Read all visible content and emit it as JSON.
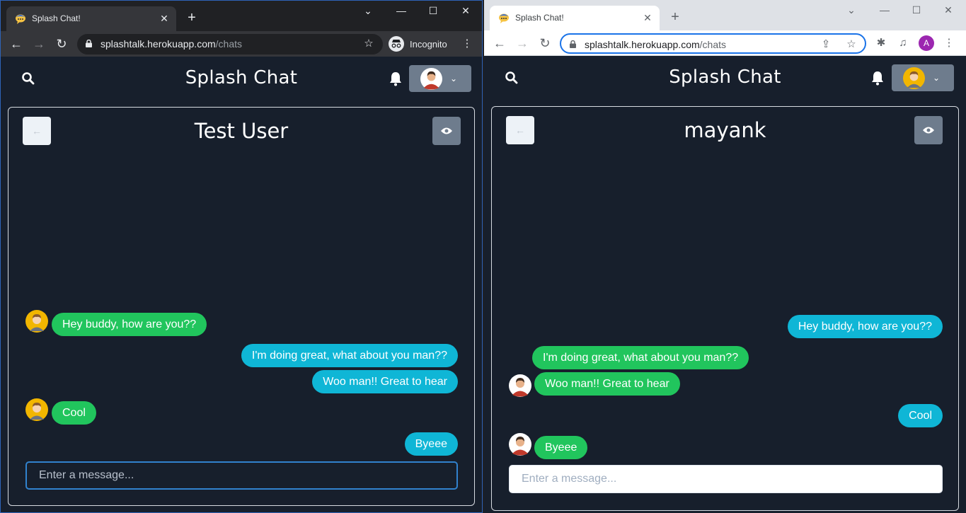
{
  "left": {
    "tab_title": "Splash Chat!",
    "url_host": "splashtalk.herokuapp.com",
    "url_path": "/chats",
    "incognito_label": "Incognito",
    "app_title": "Splash Chat",
    "chat_title": "Test User",
    "messages": [
      {
        "text": "Hey buddy, how are you??",
        "side": "left",
        "color": "green",
        "avatar": "user-icon"
      },
      {
        "text": "I'm doing great, what about you man??",
        "side": "right",
        "color": "blue"
      },
      {
        "text": "Woo man!! Great to hear",
        "side": "right",
        "color": "blue"
      },
      {
        "text": "Cool",
        "side": "left",
        "color": "green",
        "avatar": "user-icon"
      },
      {
        "text": "Byeee",
        "side": "right",
        "color": "blue"
      }
    ],
    "input_placeholder": "Enter a message..."
  },
  "right": {
    "tab_title": "Splash Chat!",
    "url_host": "splashtalk.herokuapp.com",
    "url_path": "/chats",
    "profile_letter": "A",
    "app_title": "Splash Chat",
    "chat_title": "mayank",
    "messages": [
      {
        "text": "Hey buddy, how are you??",
        "side": "right",
        "color": "blue"
      },
      {
        "text": "I'm doing great, what about you man??",
        "side": "left",
        "color": "green"
      },
      {
        "text": "Woo man!! Great to hear",
        "side": "left",
        "color": "green",
        "avatar": "user-icon"
      },
      {
        "text": "Cool",
        "side": "right",
        "color": "blue"
      },
      {
        "text": "Byeee",
        "side": "left",
        "color": "green",
        "avatar": "user-icon"
      }
    ],
    "input_placeholder": "Enter a message..."
  },
  "colors": {
    "app_bg": "#171f2c",
    "sent_bubble": "#0fb6d6",
    "received_bubble": "#21c55d",
    "menu_button": "#6e7c8d",
    "incognito_accent": "#2e63b8"
  }
}
